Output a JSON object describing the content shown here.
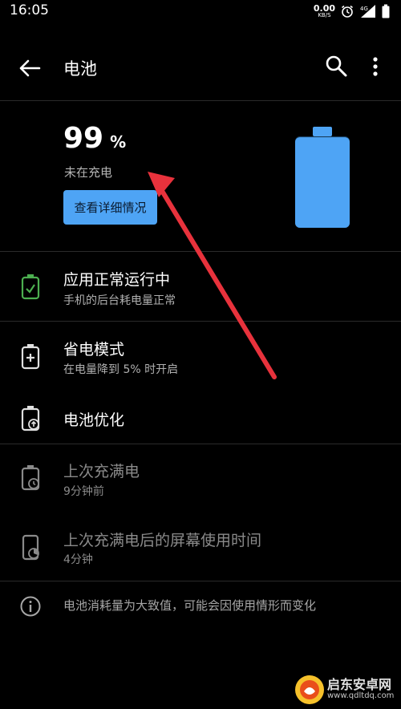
{
  "status_bar": {
    "time": "16:05",
    "net_speed_value": "0.00",
    "net_speed_unit": "KB/S",
    "signal_label": "4G",
    "icons": [
      "alarm-icon",
      "signal-icon",
      "battery-icon"
    ]
  },
  "app_bar": {
    "title": "电池",
    "icons": [
      "back-arrow-icon",
      "search-icon",
      "more-vert-icon"
    ]
  },
  "battery": {
    "level": 99,
    "level_text": "99",
    "unit": "%",
    "status": "未在充电",
    "details_button": "查看详细情况",
    "fill_color": "#4ea4f5"
  },
  "items": [
    {
      "title": "应用正常运行中",
      "subtitle": "手机的后台耗电量正常",
      "icon": "battery-ok-icon",
      "icon_color": "#4caf50"
    },
    {
      "title": "省电模式",
      "subtitle": "在电量降到 5% 时开启",
      "icon": "battery-saver-icon"
    },
    {
      "title": "电池优化",
      "subtitle": "",
      "icon": "battery-optimize-icon"
    },
    {
      "title": "上次充满电",
      "subtitle": "9分钟前",
      "icon": "battery-clock-icon"
    },
    {
      "title": "上次充满电后的屏幕使用时间",
      "subtitle": "4分钟",
      "icon": "screen-time-icon"
    }
  ],
  "info": {
    "text": "电池消耗量为大致值，可能会因使用情形而变化",
    "icon": "info-icon"
  },
  "annotation": {
    "arrow_color": "#e8323c"
  },
  "watermark": {
    "text": "启东安卓网",
    "url": "www.qdltdq.com"
  },
  "colors": {
    "background": "#000000",
    "accent": "#4ea4f5",
    "divider": "#2a2a2a"
  }
}
